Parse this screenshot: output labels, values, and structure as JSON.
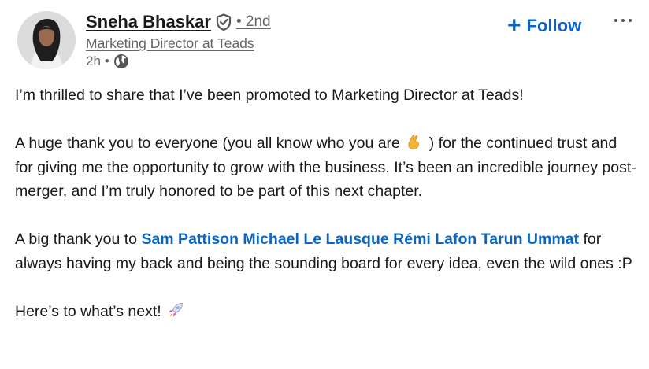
{
  "author": {
    "name": "Sneha Bhaskar",
    "degree": "• 2nd",
    "headline": "Marketing Director at Teads",
    "time": "2h",
    "time_separator": "•"
  },
  "actions": {
    "follow_plus": "+",
    "follow_label": "Follow",
    "more_icon": "ellipsis-icon"
  },
  "post": {
    "line1": "I’m thrilled to share that I’ve been promoted to Marketing Director at Teads!",
    "para2_before": "A huge thank you to everyone (you all know who you are",
    "para2_after": ") for the continued trust and for giving me the opportunity to grow with the business. It’s been an incredible journey post-merger, and I’m truly honored to be part of this next chapter.",
    "para3_before": "A big thank you to",
    "mentions": [
      "Sam Pattison",
      "Michael Le Lausque",
      "Rémi Lafon",
      "Tarun Ummat"
    ],
    "para3_after": "for always having my back and being the sounding board for every idea, even the wild ones :P",
    "closing": "Here’s to what’s next!"
  },
  "icons": {
    "verified": "verified-shield-icon",
    "globe": "globe-icon",
    "emoji_hand": "crossed-fingers-emoji",
    "emoji_rocket": "rocket-emoji"
  },
  "colors": {
    "link_blue": "#0a66c2",
    "text": "#191919",
    "muted": "#666666"
  }
}
